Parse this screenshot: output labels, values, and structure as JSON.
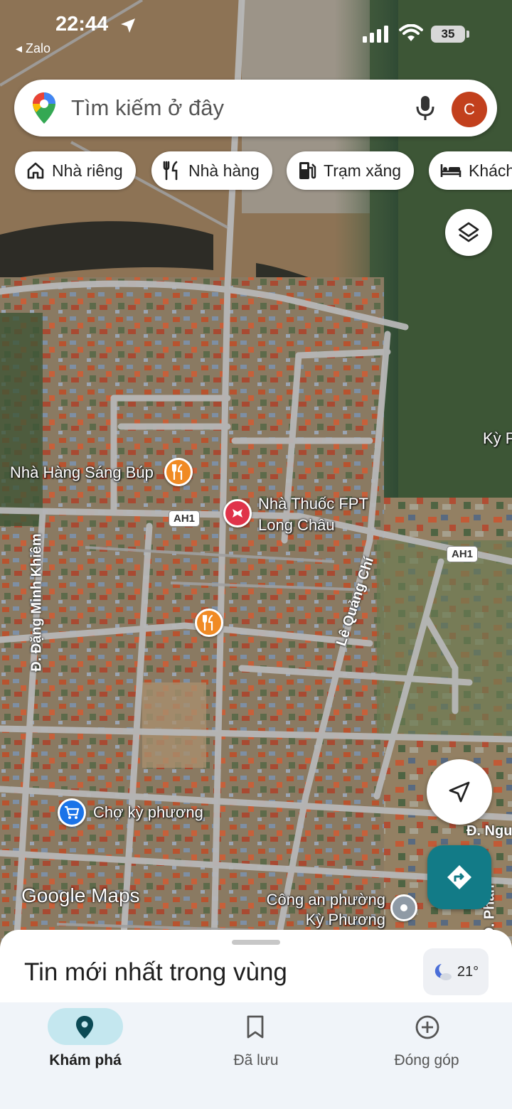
{
  "status_bar": {
    "time": "22:44",
    "back_app": "◂ Zalo",
    "battery": "35"
  },
  "search": {
    "placeholder": "Tìm kiếm ở đây",
    "avatar_letter": "C",
    "logo_icon": "google-maps-pin-icon",
    "mic_icon": "microphone-icon"
  },
  "chips": [
    {
      "label": "Nhà riêng",
      "icon": "home-icon"
    },
    {
      "label": "Nhà hàng",
      "icon": "restaurant-icon"
    },
    {
      "label": "Trạm xăng",
      "icon": "gas-station-icon"
    },
    {
      "label": "Khách",
      "icon": "hotel-bed-icon"
    }
  ],
  "map": {
    "places": [
      {
        "name": "Nhà Hàng Sáng Búp",
        "type": "restaurant"
      },
      {
        "name": "Nhà Thuốc FPT Long Châu",
        "type": "pharmacy"
      },
      {
        "name": "",
        "type": "restaurant"
      },
      {
        "name": "Chợ kỳ phương",
        "type": "shopping"
      },
      {
        "name": "Công an phường Kỳ Phương",
        "type": "police"
      }
    ],
    "roads": {
      "dang_minh_khiem": "Đ. Đặng Minh Khiêm",
      "le_quang_chi": "Lê Quảng Chí",
      "ah1": "AH1",
      "d_ngu": "Đ. Ngu",
      "phan": "Đ. Phan",
      "ky_p": "Kỳ P"
    },
    "attribution": "Google Maps"
  },
  "sheet": {
    "title": "Tin mới nhất trong vùng",
    "temperature": "21°"
  },
  "nav": [
    {
      "label": "Khám phá",
      "icon": "explore-pin-icon",
      "active": true
    },
    {
      "label": "Đã lưu",
      "icon": "bookmark-icon",
      "active": false
    },
    {
      "label": "Đóng góp",
      "icon": "add-circle-icon",
      "active": false
    }
  ],
  "colors": {
    "accent_teal": "#127b87",
    "active_pill": "#c4e7ef",
    "restaurant_pin": "#f08a24",
    "pharmacy_pin": "#e0334a",
    "shopping_pin": "#1a73e8",
    "avatar": "#c2401d"
  }
}
